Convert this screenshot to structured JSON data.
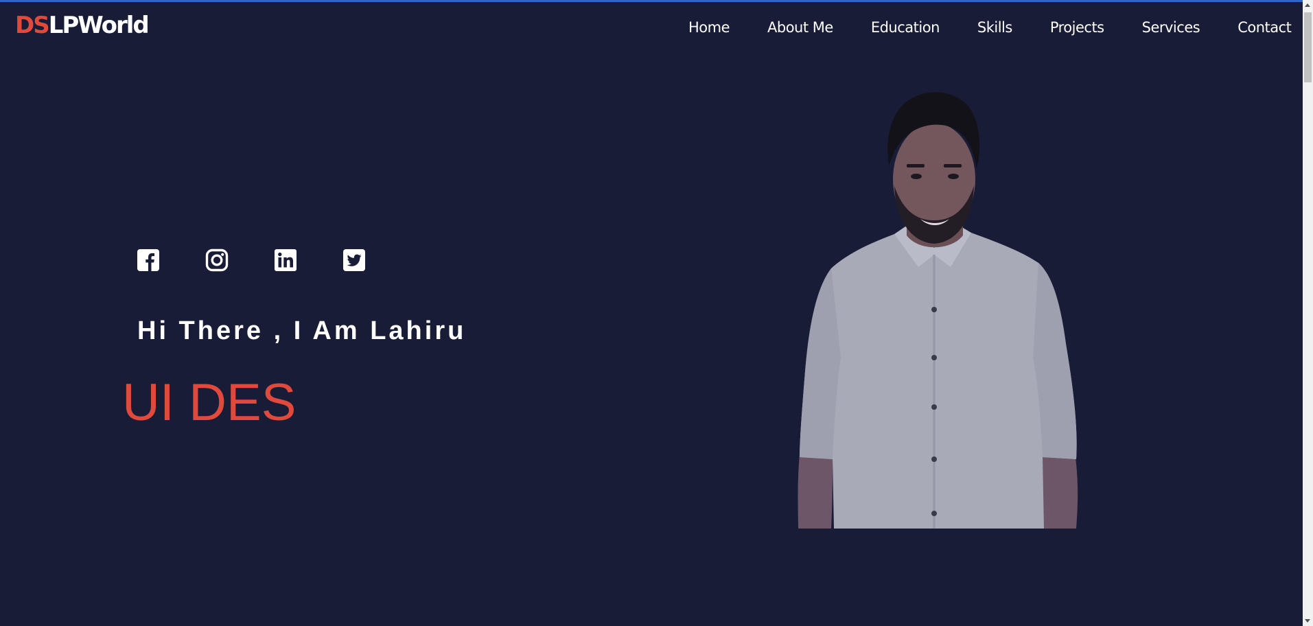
{
  "logo": {
    "accent": "DS",
    "rest": "LPWorld"
  },
  "nav": {
    "items": [
      "Home",
      "About Me",
      "Education",
      "Skills",
      "Projects",
      "Services",
      "Contact"
    ]
  },
  "social": [
    "facebook-icon",
    "instagram-icon",
    "linkedin-icon",
    "twitter-icon"
  ],
  "hero": {
    "greeting": "Hi There , I Am Lahiru",
    "typed_text": "UI DES"
  },
  "colors": {
    "background": "#181c37",
    "accent": "#e04a3c",
    "text": "#ffffff"
  }
}
